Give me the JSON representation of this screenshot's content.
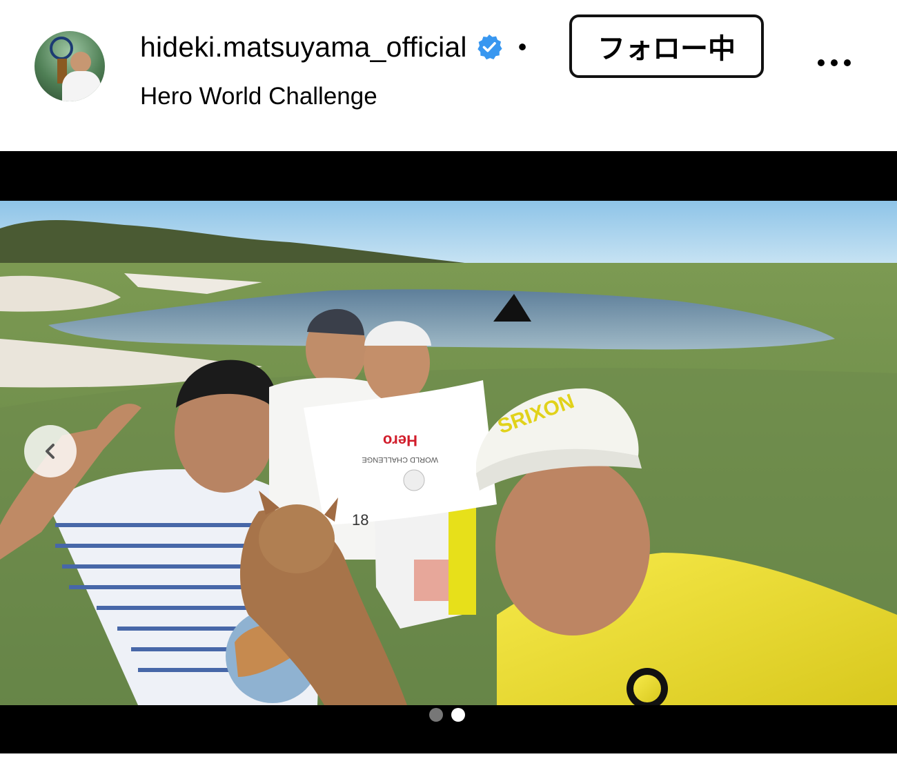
{
  "post_header": {
    "username": "hideki.matsuyama_official",
    "separator": "•",
    "follow_label": "フォロー中",
    "location": "Hero World Challenge"
  },
  "icons": {
    "verified": "verified-badge-icon",
    "more": "more-options-icon",
    "prev": "chevron-left-icon"
  },
  "media": {
    "current_slide": 2,
    "slide_count": 2,
    "photo_text": {
      "flag_brand": "Hero",
      "flag_event": "WORLD CHALLENGE",
      "cap_brand": "SRIXON",
      "flag_number": "18"
    }
  },
  "colors": {
    "verified_blue": "#3897f0",
    "shirt_yellow": "#f4e23a",
    "sky_blue": "#a9d3ee",
    "grass_green": "#6f8f4a"
  }
}
